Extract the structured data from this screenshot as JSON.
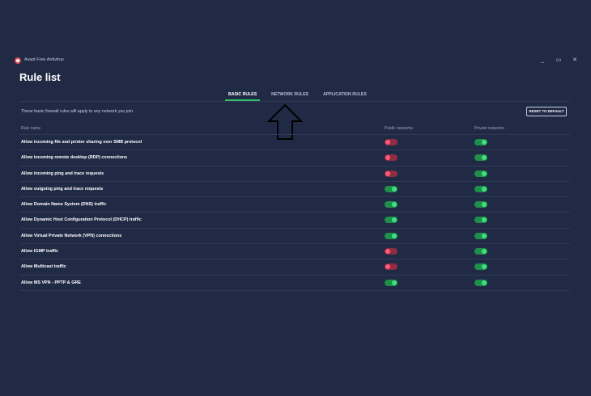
{
  "window": {
    "title": "Avast Free Antivirus",
    "controls": [
      "_",
      "▭",
      "✕"
    ]
  },
  "page": {
    "title": "Rule list"
  },
  "tabs": [
    {
      "label": "BASIC RULES",
      "active": true
    },
    {
      "label": "NETWORK RULES",
      "active": false
    },
    {
      "label": "APPLICATION RULES",
      "active": false
    }
  ],
  "intro": "These basic firewall rules will apply to any network you join.",
  "reset_label": "RESET TO DEFAULT",
  "columns": {
    "name": "Rule name",
    "public": "Public networks",
    "private": "Private networks"
  },
  "rules": [
    {
      "name": "Allow incoming file and printer sharing over SMB protocol",
      "public": "off",
      "private": "on"
    },
    {
      "name": "Allow incoming remote desktop (RDP) connections",
      "public": "off",
      "private": "on"
    },
    {
      "name": "Allow incoming ping and trace requests",
      "public": "off",
      "private": "on"
    },
    {
      "name": "Allow outgoing ping and trace requests",
      "public": "on",
      "private": "on"
    },
    {
      "name": "Allow Domain Name System (DNS) traffic",
      "public": "on",
      "private": "on"
    },
    {
      "name": "Allow Dynamic Host Configuration Protocol (DHCP) traffic",
      "public": "on",
      "private": "on"
    },
    {
      "name": "Allow Virtual Private Network (VPN) connections",
      "public": "on",
      "private": "on"
    },
    {
      "name": "Allow IGMP traffic",
      "public": "off",
      "private": "on"
    },
    {
      "name": "Allow Multicast traffic",
      "public": "off",
      "private": "on"
    },
    {
      "name": "Allow MS VPN - PPTP & GRE",
      "public": "on",
      "private": "on"
    }
  ],
  "colors": {
    "background": "#212a45",
    "toggle_on": "#1f8f4b",
    "toggle_off": "#8e2d44",
    "tab_accent": "#2ec36a"
  }
}
